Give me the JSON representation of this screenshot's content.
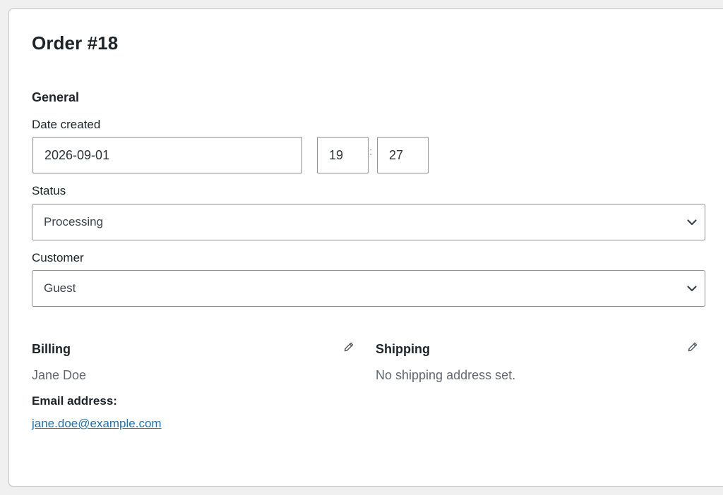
{
  "order": {
    "title": "Order #18"
  },
  "general": {
    "heading": "General",
    "date_created": {
      "label": "Date created",
      "date": "2026-09-01",
      "hour": "19",
      "minute": "27",
      "separator": ":"
    },
    "status": {
      "label": "Status",
      "selected": "Processing"
    },
    "customer": {
      "label": "Customer",
      "selected": "Guest"
    }
  },
  "billing": {
    "heading": "Billing",
    "name": "Jane Doe",
    "email_label": "Email address:",
    "email": "jane.doe@example.com",
    "edit_icon": "pencil-icon"
  },
  "shipping": {
    "heading": "Shipping",
    "empty_text": "No shipping address set.",
    "edit_icon": "pencil-icon"
  },
  "colors": {
    "link": "#2271b1",
    "muted_text": "#646970",
    "border": "#8c8f94"
  }
}
